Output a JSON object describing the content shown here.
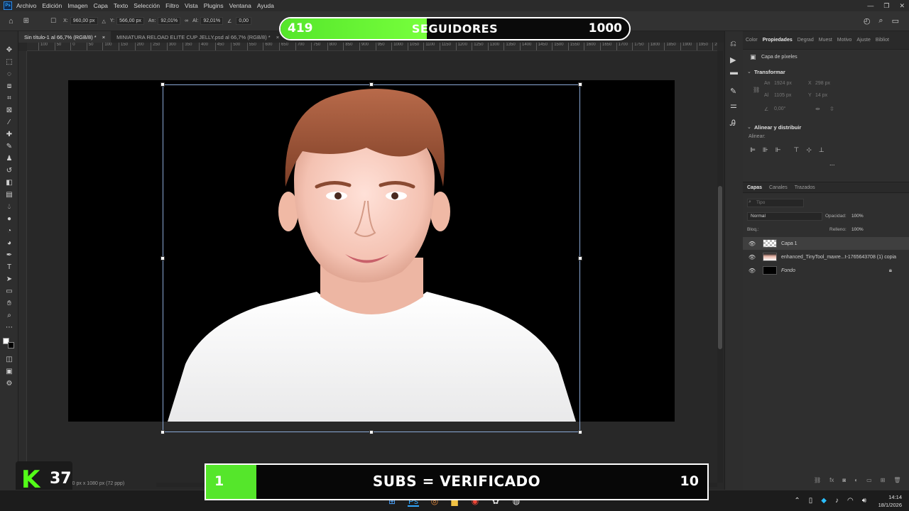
{
  "menu": [
    "Archivo",
    "Edición",
    "Imagen",
    "Capa",
    "Texto",
    "Selección",
    "Filtro",
    "Vista",
    "Plugins",
    "Ventana",
    "Ayuda"
  ],
  "options": {
    "x_label": "X:",
    "x_value": "960,00 px",
    "y_label": "Y:",
    "y_value": "566,00 px",
    "w_label": "An:",
    "w_value": "92,01%",
    "h_label": "Al:",
    "h_value": "92,01%",
    "angle_value": "0,00"
  },
  "followers": {
    "current": "419",
    "label": "SEGUIDORES",
    "goal": "1000",
    "progress": 0.419
  },
  "tabs": [
    {
      "label": "Sin título-1 al 66,7% (RGB/8) *"
    },
    {
      "label": "MINIATURA RELOAD ELITE CUP JELLY.psd al 66,7% (RGB/8) *"
    }
  ],
  "ruler_ticks": [
    "100",
    "50",
    "0",
    "50",
    "100",
    "150",
    "200",
    "250",
    "300",
    "350",
    "400",
    "450",
    "500",
    "550",
    "600",
    "650",
    "700",
    "750",
    "800",
    "850",
    "900",
    "950",
    "1000",
    "1050",
    "1100",
    "1150",
    "1200",
    "1250",
    "1300",
    "1350",
    "1400",
    "1450",
    "1500",
    "1550",
    "1600",
    "1650",
    "1700",
    "1750",
    "1800",
    "1850",
    "1900",
    "1950",
    "2000"
  ],
  "status": {
    "doc_size": "1920 px x 1080 px (72 ppp)"
  },
  "properties": {
    "tabs": [
      "Color",
      "Propiedades",
      "Degrad",
      "Muest",
      "Motivo",
      "Ajuste",
      "Bibliot"
    ],
    "pixel_layer": "Capa de píxeles",
    "transform_title": "Transformar",
    "w_label": "An",
    "w_value": "1924 px",
    "x_label": "X",
    "x_value": "298 px",
    "h_label": "Al",
    "h_value": "1105 px",
    "y_label": "Y",
    "y_value": "14 px",
    "angle": "0,00°",
    "align_title": "Alinear y distribuir",
    "align_label": "Alinear:",
    "more": "..."
  },
  "layers_panel": {
    "tabs": [
      "Capas",
      "Canales",
      "Trazados"
    ],
    "search_placeholder": "Tipo",
    "blend_mode": "Normal",
    "opacity_label": "Opacidad:",
    "opacity_value": "100%",
    "lock_label": "Bloq.:",
    "fill_label": "Relleno:",
    "fill_value": "100%",
    "layers": [
      {
        "name": "Capa 1"
      },
      {
        "name": "enhanced_TinyTool_maxre...t-1765643708 (1) copia"
      },
      {
        "name": "Fondo"
      }
    ]
  },
  "subs_goal": {
    "current": "1",
    "label": "SUBS = VERIFICADO",
    "goal": "10",
    "progress": 0.1
  },
  "kick": {
    "count": "37"
  },
  "taskbar": {
    "time": "14:14",
    "date": "18/1/2026"
  },
  "colors": {
    "accent_green": "#55e62b",
    "kick_green": "#53fc18"
  }
}
